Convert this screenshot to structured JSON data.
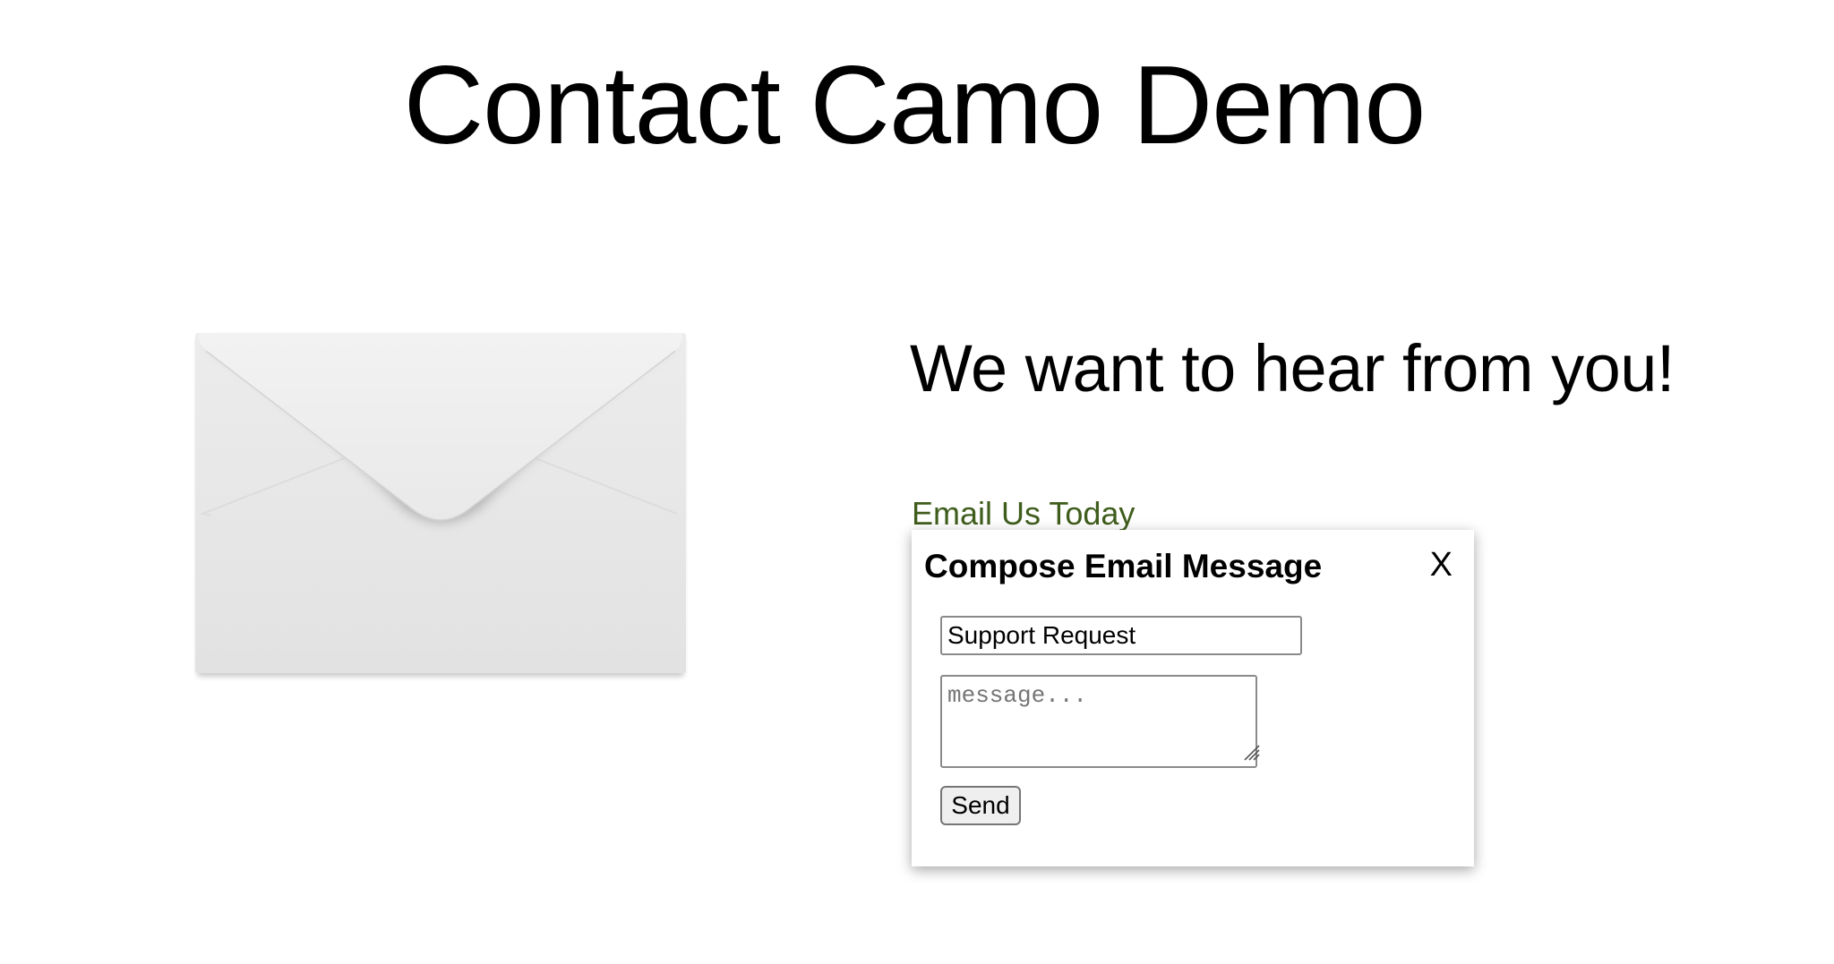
{
  "header": {
    "title": "Contact Camo Demo"
  },
  "hero": {
    "image_icon": "envelope-icon",
    "tagline": "We want to hear from you!"
  },
  "contact": {
    "link_label": "Email Us Today",
    "link_color": "#3f5d1c"
  },
  "compose_dialog": {
    "title": "Compose Email Message",
    "close_label": "X",
    "subject_value": "Support Request",
    "message_placeholder": "message...",
    "send_label": "Send"
  }
}
